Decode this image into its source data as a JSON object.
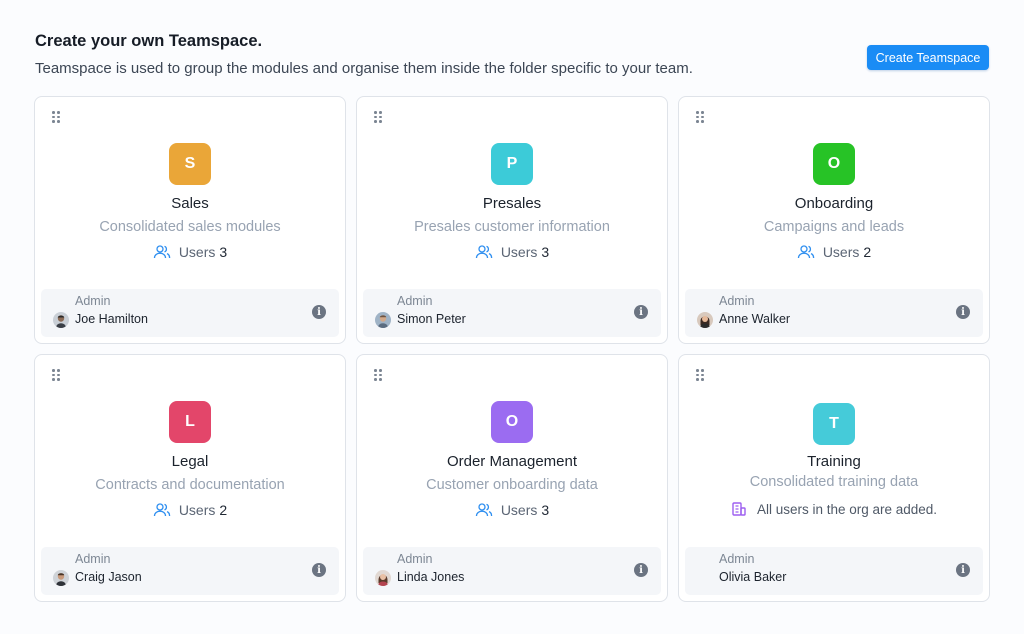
{
  "header": {
    "title": "Create your own Teamspace.",
    "subtitle": "Teamspace is used to group the modules and organise them inside the folder specific to your team.",
    "create_button": "Create Teamspace"
  },
  "admin_label": "Admin",
  "users_label": "Users",
  "colors": {
    "sales": "#eaa638",
    "presales": "#3ccbd8",
    "onboarding": "#27c326",
    "legal": "#e3466a",
    "order_management": "#9b6cf1",
    "training": "#45cbd9",
    "accent": "#1a8cf5"
  },
  "cards": [
    {
      "letter": "S",
      "name": "Sales",
      "description": "Consolidated sales modules",
      "users": "3",
      "admin": "Joe Hamilton"
    },
    {
      "letter": "P",
      "name": "Presales",
      "description": "Presales customer information",
      "users": "3",
      "admin": "Simon Peter"
    },
    {
      "letter": "O",
      "name": "Onboarding",
      "description": "Campaigns and leads",
      "users": "2",
      "admin": "Anne Walker"
    },
    {
      "letter": "L",
      "name": "Legal",
      "description": "Contracts and documentation",
      "users": "2",
      "admin": "Craig Jason"
    },
    {
      "letter": "O",
      "name": "Order Management",
      "description": "Customer onboarding data",
      "users": "3",
      "admin": "Linda Jones"
    },
    {
      "letter": "T",
      "name": "Training",
      "description": "Consolidated training data",
      "note": "All users in the org are added.",
      "admin": "Olivia Baker"
    }
  ]
}
